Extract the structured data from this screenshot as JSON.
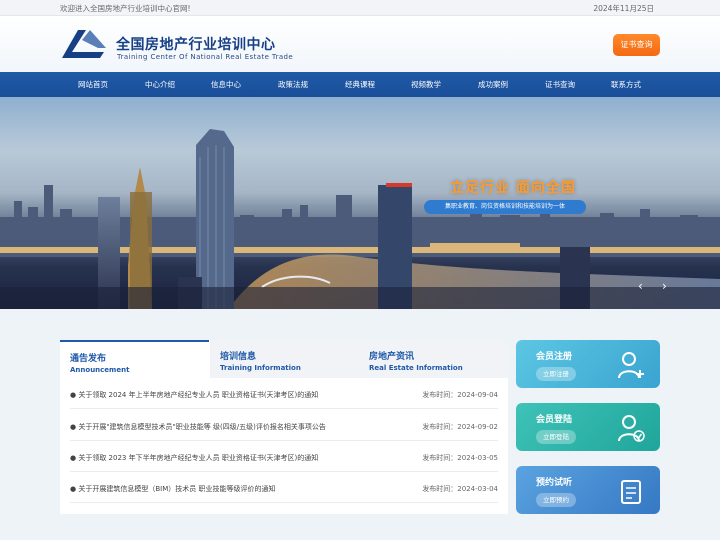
{
  "topbar": {
    "welcome": "欢迎进入全国房地产行业培训中心官网!",
    "date": "2024年11月25日"
  },
  "header": {
    "brand_cn": "全国房地产行业培训中心",
    "brand_en": "Training  Center Of National  Real Estate Trade",
    "cert_button": "证书查询"
  },
  "nav": {
    "items": [
      "网站首页",
      "中心介绍",
      "信息中心",
      "政策法规",
      "经典课程",
      "视频教学",
      "成功案例",
      "证书查询",
      "联系方式"
    ]
  },
  "banner": {
    "slogan": "立足行业  面向全国",
    "sub": "集职业教育、岗位资格培训和技能培训为一体",
    "prev": "‹",
    "next": "›"
  },
  "tabs": [
    {
      "cn": "通告发布",
      "en": "Announcement"
    },
    {
      "cn": "培训信息",
      "en": "Training Information"
    },
    {
      "cn": "房地产资讯",
      "en": "Real Estate Information"
    }
  ],
  "announcements": [
    {
      "title": "● 关于领取 2024 年上半年房地产经纪专业人员 职业资格证书(天津考区)的通知",
      "time": "发布时间：2024-09-04"
    },
    {
      "title": "● 关于开展\"建筑信息模型技术员\"职业技能等 级(四级/五级)评价报名相关事项公告",
      "time": "发布时间：2024-09-02"
    },
    {
      "title": "● 关于领取 2023 年下半年房地产经纪专业人员 职业资格证书(天津考区)的通知",
      "time": "发布时间：2024-03-05"
    },
    {
      "title": "● 关于开展建筑信息模型（BIM）技术员 职业技能等级评价的通知",
      "time": "发布时间：2024-03-04"
    }
  ],
  "side": [
    {
      "label": "会员注册",
      "button": "立即注册",
      "icon": "user-add-icon",
      "color": "#48b8d8"
    },
    {
      "label": "会员登陆",
      "button": "立即登陆",
      "icon": "user-check-icon",
      "color": "#2fb3a8"
    },
    {
      "label": "预约试听",
      "button": "立即预约",
      "icon": "clipboard-icon",
      "color": "#3c8cd0"
    }
  ],
  "colors": {
    "primary": "#1f5aa8",
    "accent": "#f46812"
  }
}
